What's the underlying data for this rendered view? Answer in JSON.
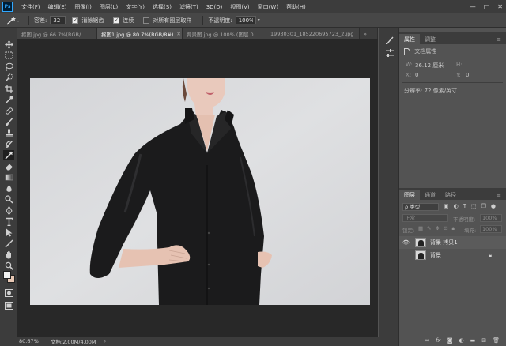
{
  "app": {
    "logo_text": "Ps"
  },
  "menubar": {
    "items": [
      "文件(F)",
      "编辑(E)",
      "图像(I)",
      "图层(L)",
      "文字(Y)",
      "选择(S)",
      "滤镜(T)",
      "3D(D)",
      "视图(V)",
      "窗口(W)",
      "帮助(H)"
    ]
  },
  "window_controls": {
    "minimize": "—",
    "maximize": "□",
    "close": "✕"
  },
  "options": {
    "tolerance_label": "容差:",
    "tolerance_value": "32",
    "antialias_label": "消除锯齿",
    "antialias_checked": true,
    "contiguous_label": "连续",
    "contiguous_checked": true,
    "sample_all_label": "对所有图层取样",
    "sample_all_checked": false,
    "opacity_label": "不透明度:",
    "opacity_value": "100%"
  },
  "tabs": [
    {
      "label": "抠图.jpg @ 66.7%(RGB/...",
      "active": false
    },
    {
      "label": "抠图1.jpg @ 80.7%(RGB/8#)",
      "active": true
    },
    {
      "label": "背景图.jpg @ 100% (图层 0...",
      "active": false
    },
    {
      "label": "19930301_185220695723_2.jpg",
      "active": false
    }
  ],
  "status": {
    "zoom": "80.67%",
    "doc": "文档:2.00M/4.00M"
  },
  "properties": {
    "tabs": [
      "属性",
      "调整"
    ],
    "section": "文档属性",
    "w_label": "W:",
    "w_value": "36.12 厘米",
    "h_label": "H:",
    "h_value": "",
    "x_label": "X:",
    "x_value": "0",
    "y_label": "Y:",
    "y_value": "0",
    "resolution": "分辨率: 72 像素/英寸"
  },
  "layers_panel": {
    "tabs": [
      "图层",
      "通道",
      "路径"
    ],
    "filter_label": "ρ 类型",
    "blend_mode": "正常",
    "opacity_label": "不透明度:",
    "opacity_value": "100%",
    "lock_label": "锁定:",
    "fill_label": "填充:",
    "fill_value": "100%",
    "layers": [
      {
        "name": "背景 拷贝1",
        "visible": true,
        "locked": false
      },
      {
        "name": "背景",
        "visible": false,
        "locked": true
      }
    ],
    "footer_icons": [
      "link-icon",
      "fx-icon",
      "mask-icon",
      "adjustment-icon",
      "folder-icon",
      "new-layer-icon",
      "trash-icon"
    ]
  },
  "colors": {
    "foreground": "#f2f2f2",
    "background": "#e8c8b4",
    "accent": "#31a8ff"
  }
}
